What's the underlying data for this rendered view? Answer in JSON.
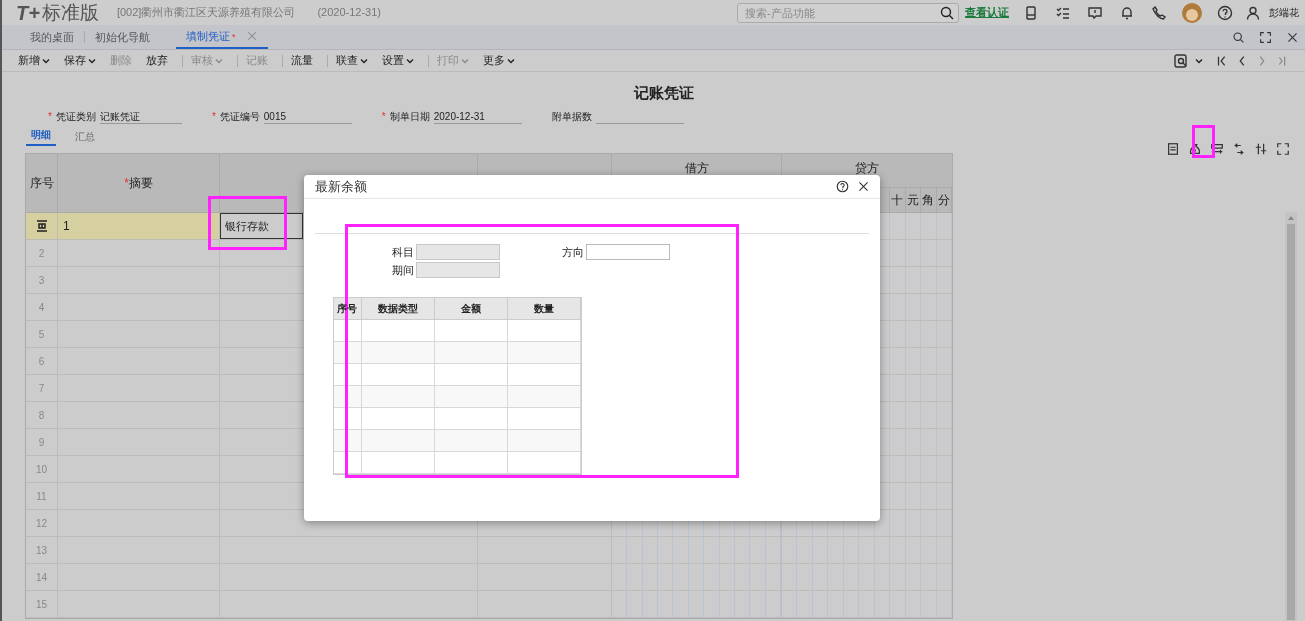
{
  "app": {
    "logo_mark": "T+",
    "edition": "标准版",
    "company": "[002]衢州市衢江区天源养殖有限公司",
    "date": "(2020-12-31)",
    "search": {
      "placeholder": "搜索-产品功能"
    },
    "link": "查看认证",
    "user": "彭端花"
  },
  "tabs": [
    {
      "label": "我的桌面",
      "selected": false
    },
    {
      "label": "初始化导航",
      "selected": false
    },
    {
      "label": "填制凭证",
      "modified": "*",
      "selected": true
    }
  ],
  "toolbar_groups": [
    [
      {
        "label": "新增",
        "dropdown": true,
        "disabled": false
      },
      {
        "label": "保存",
        "dropdown": true,
        "disabled": false
      },
      {
        "label": "删除",
        "dropdown": false,
        "disabled": true
      },
      {
        "label": "放弃",
        "dropdown": false,
        "disabled": false
      }
    ],
    [
      {
        "label": "审核",
        "dropdown": true,
        "disabled": true
      }
    ],
    [
      {
        "label": "记账",
        "dropdown": false,
        "disabled": true
      }
    ],
    [
      {
        "label": "流量",
        "dropdown": false,
        "disabled": false
      }
    ],
    [
      {
        "label": "联查",
        "dropdown": true,
        "disabled": false
      },
      {
        "label": "设置",
        "dropdown": true,
        "disabled": false
      }
    ],
    [
      {
        "label": "打印",
        "dropdown": true,
        "disabled": true
      },
      {
        "label": "更多",
        "dropdown": true,
        "disabled": false
      }
    ]
  ],
  "voucher": {
    "title": "记账凭证",
    "fields": [
      {
        "label": "凭证类别",
        "value": "记账凭证",
        "required": true
      },
      {
        "label": "凭证编号",
        "value": "0015",
        "required": true
      },
      {
        "label": "制单日期",
        "value": "2020-12-31",
        "required": true
      },
      {
        "label": "附单据数",
        "required": false
      }
    ],
    "subtabs": [
      {
        "label": "明细",
        "selected": true
      },
      {
        "label": "汇总",
        "selected": false
      }
    ]
  },
  "table": {
    "number_header": "序号",
    "summary_header": "摘要",
    "summary_required": true,
    "debit_header": "借方",
    "credit_header": "贷方",
    "credit_digits": [
      "十",
      "元",
      "角",
      "分"
    ],
    "rows": [
      {
        "summary": "1",
        "account": "银行存款",
        "selected": true
      },
      {
        "number": "2",
        "selected": false
      },
      {
        "number": "3",
        "selected": false
      },
      {
        "number": "4",
        "selected": false
      },
      {
        "number": "5",
        "selected": false
      },
      {
        "number": "6",
        "selected": false
      },
      {
        "number": "7",
        "selected": false
      },
      {
        "number": "8",
        "selected": false
      },
      {
        "number": "9",
        "selected": false
      },
      {
        "number": "10",
        "selected": false
      },
      {
        "number": "11",
        "selected": false
      },
      {
        "number": "12",
        "selected": false
      },
      {
        "number": "13",
        "selected": false
      },
      {
        "number": "14",
        "selected": false
      },
      {
        "number": "15",
        "selected": false
      }
    ]
  },
  "dialog": {
    "title": "最新余额",
    "fields": [
      {
        "label": "科目",
        "disabled": true
      },
      {
        "label": "期间",
        "disabled": true
      },
      {
        "label": "方向",
        "disabled": false
      }
    ],
    "grid_columns": [
      "序号",
      "数据类型",
      "金额",
      "数量"
    ]
  },
  "highlight_frames": [
    {
      "kind": "frame"
    },
    {
      "kind": "frame"
    },
    {
      "kind": "frame"
    }
  ]
}
